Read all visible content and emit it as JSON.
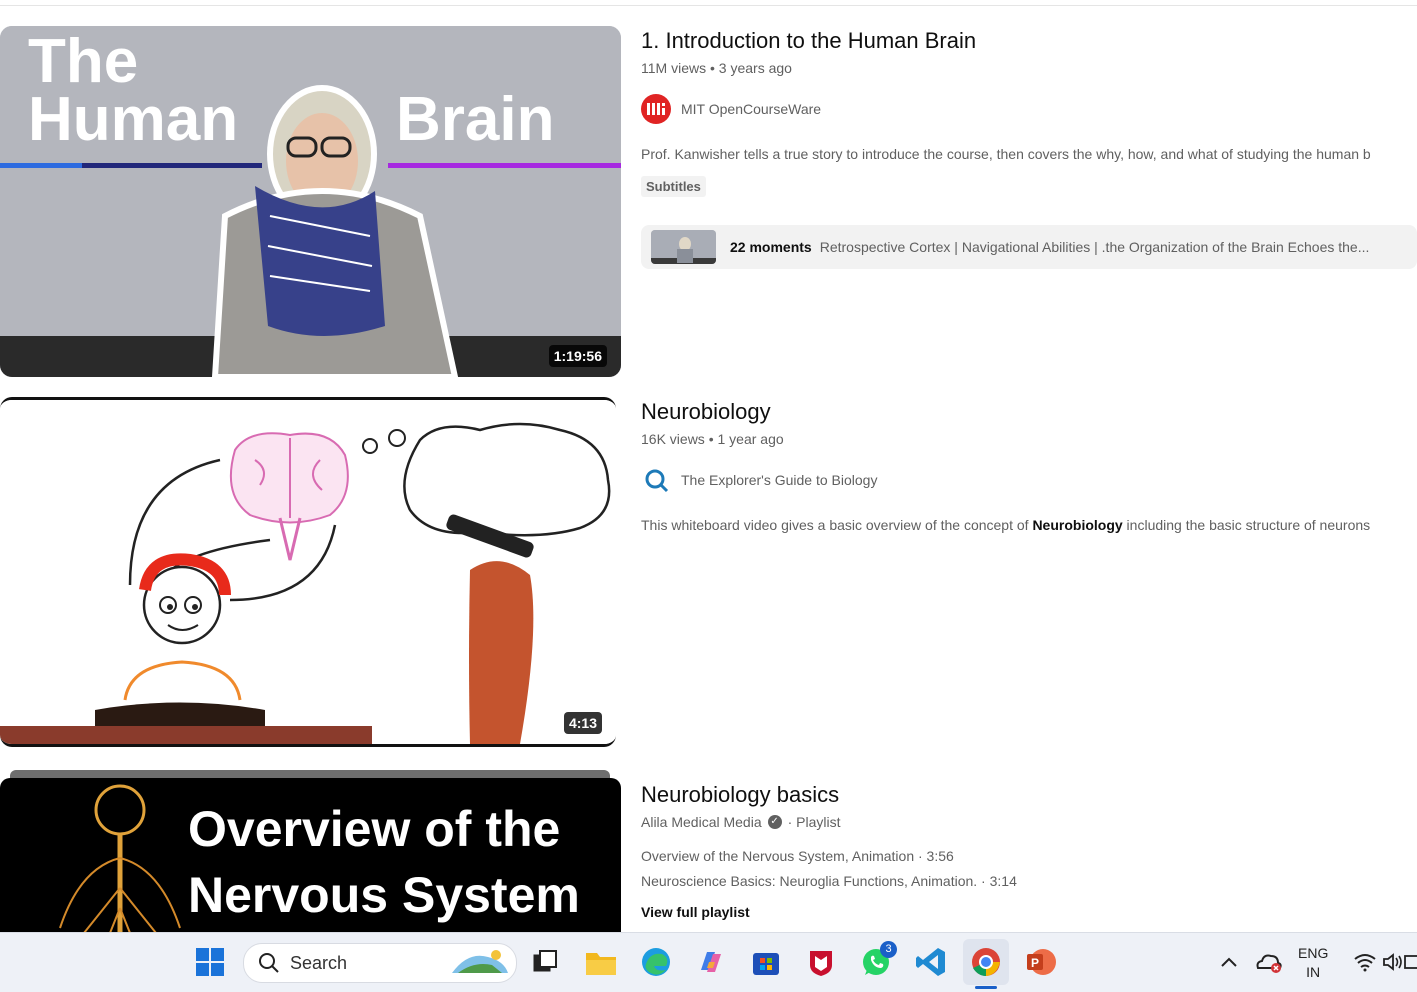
{
  "results": [
    {
      "title": "1. Introduction to the Human Brain",
      "views": "11M views",
      "age": "3 years ago",
      "channel": "MIT OpenCourseWare",
      "description": "Prof. Kanwisher tells a true story to introduce the course, then covers the why, how, and what of studying the human b",
      "badge": "Subtitles",
      "duration": "1:19:56",
      "thumb_text_1": "The",
      "thumb_text_2": "Human",
      "thumb_text_3": "Brain",
      "moments_count": "22 moments",
      "moments_text": "Retrospective Cortex | Navigational Abilities | .the Organization of the Brain Echoes the..."
    },
    {
      "title": "Neurobiology",
      "views": "16K views",
      "age": "1 year ago",
      "channel": "The Explorer's Guide to Biology",
      "description_pre": "This whiteboard video gives a basic overview of the concept of ",
      "description_bold": "Neurobiology",
      "description_post": " including the basic structure of neurons",
      "duration": "4:13"
    },
    {
      "title": "Neurobiology basics",
      "channel": "Alila Medical Media",
      "kind": "Playlist",
      "thumb_text_1": "Overview of the",
      "thumb_text_2": "Nervous System",
      "items": [
        "Overview of the Nervous System, Animation · 3:56",
        "Neuroscience Basics: Neuroglia Functions, Animation. · 3:14"
      ],
      "view_full": "View full playlist"
    }
  ],
  "taskbar": {
    "search_placeholder": "Search",
    "whatsapp_badge": "3",
    "lang_1": "ENG",
    "lang_2": "IN"
  }
}
